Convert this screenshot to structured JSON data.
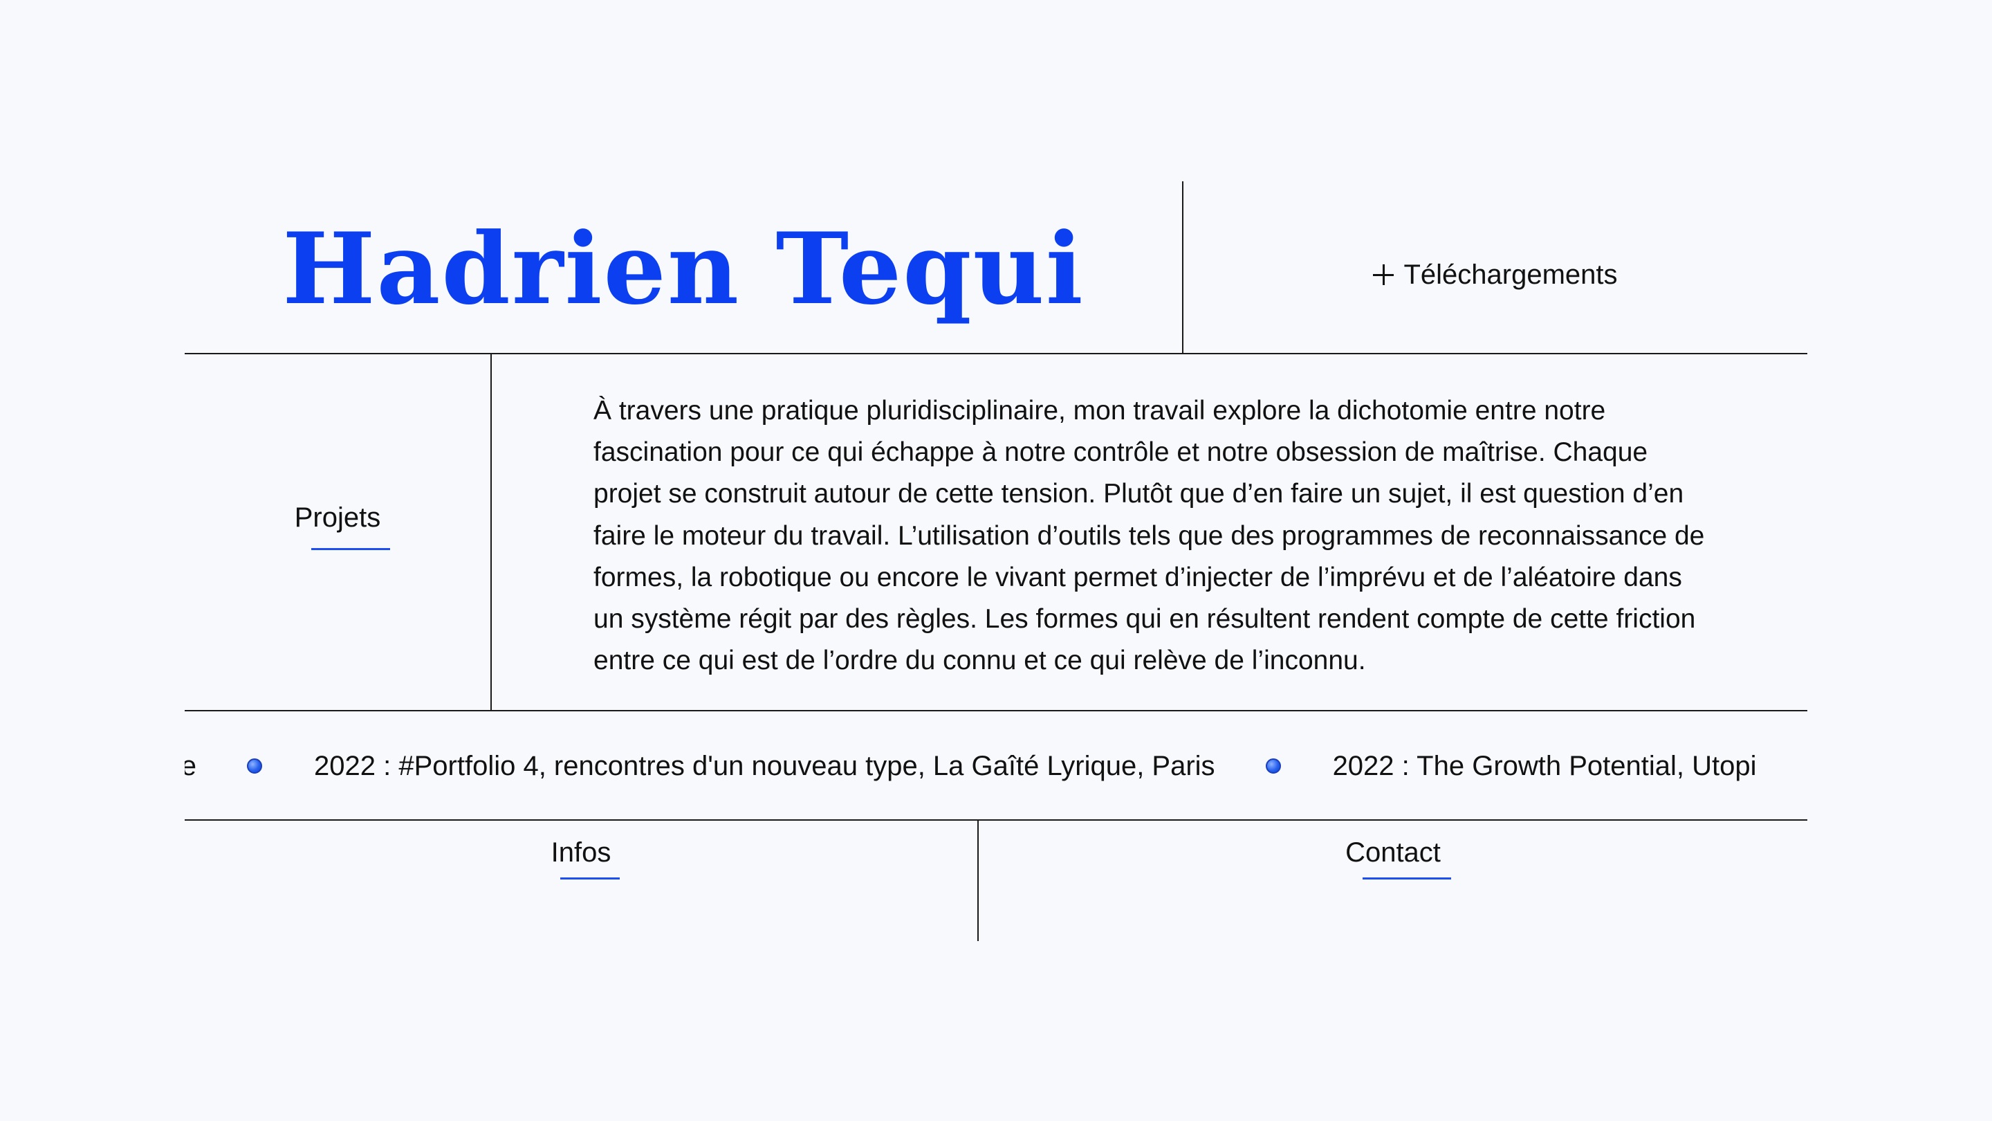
{
  "header": {
    "title": "Hadrien Tequi",
    "downloads_label": "Téléchargements"
  },
  "nav": {
    "projects_label": "Projets",
    "infos_label": "Infos",
    "contact_label": "Contact"
  },
  "bio": {
    "text": "À travers une pratique pluridisciplinaire, mon travail explore la dichotomie entre notre fascination pour ce qui échappe à notre contrôle et notre obsession de maîtrise. Chaque projet se construit autour de cette tension. Plutôt que d’en faire un sujet, il est question d’en faire le moteur du travail. L’utilisation d’outils tels que des programmes de reconnaissance de formes, la robotique ou encore le vivant permet d’injecter de l’imprévu et de l’aléatoire dans un système régit par des règles. Les formes qui en résultent rendent compte de cette friction entre ce qui est de l’ordre du connu et ce qui relève de l’inconnu."
  },
  "ticker": {
    "items": [
      "ouillon, Lille",
      "2022 : #Portfolio 4, rencontres d'un nouveau type, La Gaîté Lyrique, Paris",
      "2022 : The Growth Potential, Utopi"
    ]
  },
  "colors": {
    "accent": "#0b3ff0",
    "underline": "#1d4ef0",
    "background": "#f7f9fc",
    "rule": "#1a1a1a"
  }
}
